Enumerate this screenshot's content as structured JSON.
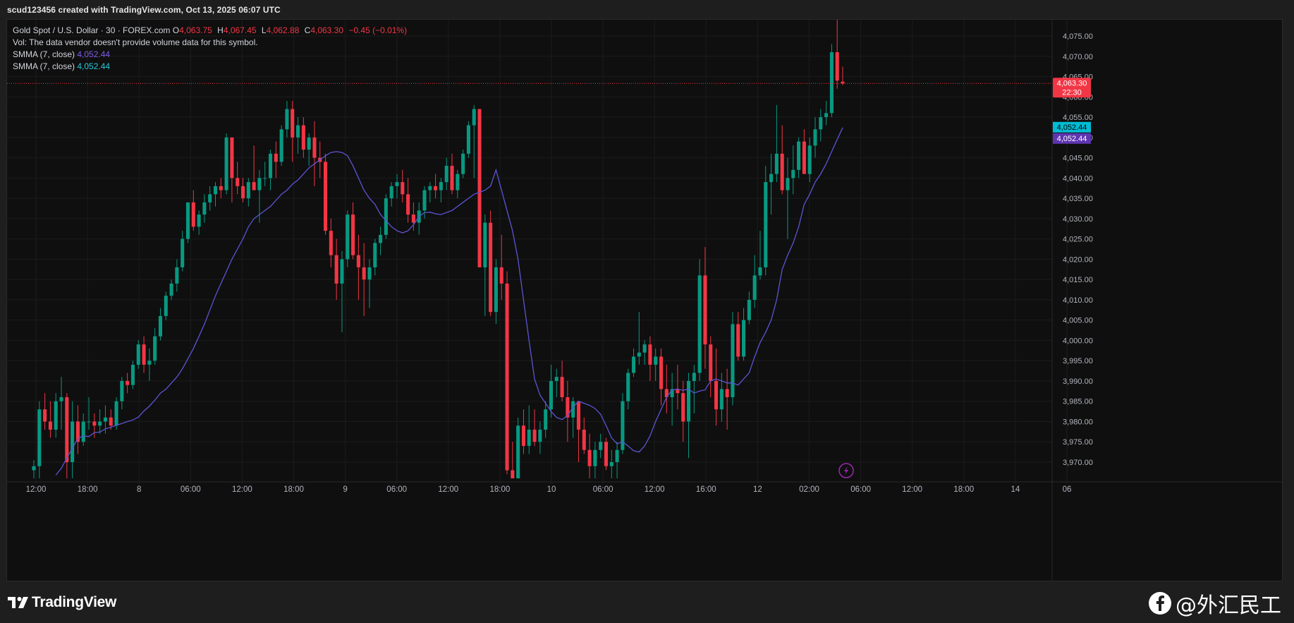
{
  "header": {
    "caption": "scud123456 created with TradingView.com, Oct 13, 2025 06:07 UTC"
  },
  "legend": {
    "symbol": "Gold Spot / U.S. Dollar · 30 · FOREX.com",
    "open_label": "O",
    "open": "4,063.75",
    "high_label": "H",
    "high": "4,067.45",
    "low_label": "L",
    "low": "4,062.88",
    "close_label": "C",
    "close": "4,063.30",
    "change": "−0.45 (−0.01%)",
    "volume_note": "Vol: The data vendor doesn't provide volume data for this symbol.",
    "smma1_label": "SMMA (7, close)",
    "smma1_value": "4,052.44",
    "smma2_label": "SMMA (7, close)",
    "smma2_value": "4,052.44"
  },
  "price_badge": {
    "price": "4,063.30",
    "countdown": "22:30"
  },
  "smma_badges": [
    "4,052.44",
    "4,052.44"
  ],
  "footer": {
    "brand": "TradingView",
    "watermark": "@外汇民工"
  },
  "colors": {
    "up": "#089981",
    "down": "#f23645",
    "smma": "#5b55d6",
    "smma_alt": "#00bcd4",
    "background": "#0f0f0f",
    "grid": "#1c1c1c"
  },
  "chart_data": {
    "type": "candlestick",
    "title": "Gold Spot / U.S. Dollar · 30 · FOREX.com",
    "ylim": [
      3966,
      4079
    ],
    "y_ticks": [
      3970,
      3975,
      3980,
      3985,
      3990,
      3995,
      4000,
      4005,
      4010,
      4015,
      4020,
      4025,
      4030,
      4035,
      4040,
      4045,
      4050,
      4055,
      4060,
      4065,
      4070,
      4075
    ],
    "x_ticks": [
      "12:00",
      "18:00",
      "8",
      "06:00",
      "12:00",
      "18:00",
      "9",
      "06:00",
      "12:00",
      "18:00",
      "10",
      "06:00",
      "12:00",
      "16:00",
      "12",
      "02:00",
      "06:00",
      "12:00",
      "18:00",
      "14",
      "06"
    ],
    "current_price": 4063.3,
    "candles": [
      [
        3968.0,
        3970.5,
        3966.0,
        3969.0
      ],
      [
        3969.0,
        3985.0,
        3966.0,
        3983.0
      ],
      [
        3983.0,
        3987.0,
        3978.0,
        3980.0
      ],
      [
        3980.0,
        3985.0,
        3976.0,
        3978.0
      ],
      [
        3978.0,
        3987.0,
        3976.0,
        3985.0
      ],
      [
        3985.0,
        3991.0,
        3978.0,
        3986.0
      ],
      [
        3986.0,
        3987.0,
        3966.0,
        3970.0
      ],
      [
        3970.0,
        3985.0,
        3966.0,
        3980.0
      ],
      [
        3980.0,
        3984.0,
        3972.0,
        3975.0
      ],
      [
        3975.0,
        3982.0,
        3974.0,
        3980.0
      ],
      [
        3980.0,
        3986.0,
        3978.0,
        3980.0
      ],
      [
        3980.0,
        3982.0,
        3976.0,
        3979.0
      ],
      [
        3979.0,
        3983.0,
        3977.0,
        3980.0
      ],
      [
        3980.0,
        3984.0,
        3977.0,
        3981.0
      ],
      [
        3981.0,
        3983.0,
        3978.0,
        3979.0
      ],
      [
        3979.0,
        3986.0,
        3978.0,
        3985.0
      ],
      [
        3985.0,
        3991.0,
        3983.0,
        3990.0
      ],
      [
        3990.0,
        3992.0,
        3987.0,
        3989.0
      ],
      [
        3989.0,
        3995.0,
        3988.0,
        3994.0
      ],
      [
        3994.0,
        4000.0,
        3993.0,
        3999.0
      ],
      [
        3999.0,
        4001.0,
        3992.0,
        3994.0
      ],
      [
        3994.0,
        3998.0,
        3990.0,
        3995.0
      ],
      [
        3995.0,
        4003.0,
        3994.0,
        4001.0
      ],
      [
        4001.0,
        4008.0,
        4000.0,
        4006.0
      ],
      [
        4006.0,
        4012.0,
        4005.0,
        4011.0
      ],
      [
        4011.0,
        4015.0,
        4010.0,
        4014.0
      ],
      [
        4014.0,
        4020.0,
        4012.0,
        4018.0
      ],
      [
        4018.0,
        4027.0,
        4017.0,
        4025.0
      ],
      [
        4025.0,
        4033.0,
        4024.0,
        4034.0
      ],
      [
        4034.0,
        4037.0,
        4027.0,
        4028.0
      ],
      [
        4028.0,
        4032.0,
        4026.0,
        4031.0
      ],
      [
        4031.0,
        4036.0,
        4029.0,
        4034.0
      ],
      [
        4034.0,
        4038.0,
        4032.0,
        4036.0
      ],
      [
        4036.0,
        4039.0,
        4033.0,
        4038.0
      ],
      [
        4038.0,
        4040.0,
        4035.0,
        4037.0
      ],
      [
        4037.0,
        4051.0,
        4036.0,
        4050.0
      ],
      [
        4050.0,
        4050.0,
        4034.0,
        4040.0
      ],
      [
        4040.0,
        4044.0,
        4036.0,
        4038.0
      ],
      [
        4038.0,
        4040.0,
        4034.0,
        4035.0
      ],
      [
        4035.0,
        4040.0,
        4033.0,
        4039.0
      ],
      [
        4039.0,
        4048.0,
        4038.0,
        4037.0
      ],
      [
        4037.0,
        4042.0,
        4029.0,
        4040.0
      ],
      [
        4040.0,
        4044.0,
        4038.0,
        4040.0
      ],
      [
        4040.0,
        4047.0,
        4037.0,
        4046.0
      ],
      [
        4046.0,
        4049.0,
        4040.0,
        4044.0
      ],
      [
        4044.0,
        4053.0,
        4043.0,
        4052.0
      ],
      [
        4052.0,
        4059.0,
        4050.0,
        4057.0
      ],
      [
        4057.0,
        4059.0,
        4044.0,
        4050.0
      ],
      [
        4050.0,
        4055.0,
        4046.0,
        4053.0
      ],
      [
        4053.0,
        4055.0,
        4045.0,
        4047.0
      ],
      [
        4047.0,
        4051.0,
        4043.0,
        4050.0
      ],
      [
        4050.0,
        4054.0,
        4038.0,
        4045.0
      ],
      [
        4045.0,
        4049.0,
        4040.0,
        4044.0
      ],
      [
        4044.0,
        4046.0,
        4026.0,
        4027.0
      ],
      [
        4027.0,
        4030.0,
        4018.0,
        4021.0
      ],
      [
        4021.0,
        4025.0,
        4010.0,
        4014.0
      ],
      [
        4014.0,
        4022.0,
        4002.0,
        4020.0
      ],
      [
        4020.0,
        4032.0,
        4018.0,
        4031.0
      ],
      [
        4031.0,
        4034.0,
        4020.0,
        4021.0
      ],
      [
        4021.0,
        4026.0,
        4010.0,
        4018.0
      ],
      [
        4018.0,
        4024.0,
        4006.0,
        4015.0
      ],
      [
        4015.0,
        4020.0,
        4008.0,
        4018.0
      ],
      [
        4018.0,
        4025.0,
        4016.0,
        4024.0
      ],
      [
        4024.0,
        4028.0,
        4021.0,
        4026.0
      ],
      [
        4026.0,
        4036.0,
        4025.0,
        4035.0
      ],
      [
        4035.0,
        4039.0,
        4033.0,
        4038.0
      ],
      [
        4038.0,
        4041.0,
        4035.0,
        4039.0
      ],
      [
        4039.0,
        4042.0,
        4034.0,
        4036.0
      ],
      [
        4036.0,
        4040.0,
        4029.0,
        4031.0
      ],
      [
        4031.0,
        4034.0,
        4027.0,
        4029.0
      ],
      [
        4029.0,
        4034.0,
        4026.0,
        4032.0
      ],
      [
        4032.0,
        4038.0,
        4030.0,
        4037.0
      ],
      [
        4037.0,
        4039.0,
        4034.0,
        4038.0
      ],
      [
        4038.0,
        4041.0,
        4035.0,
        4037.0
      ],
      [
        4037.0,
        4040.0,
        4034.0,
        4039.0
      ],
      [
        4039.0,
        4045.0,
        4037.0,
        4043.0
      ],
      [
        4043.0,
        4046.0,
        4036.0,
        4037.0
      ],
      [
        4037.0,
        4042.0,
        4035.0,
        4041.0
      ],
      [
        4041.0,
        4047.0,
        4040.0,
        4046.0
      ],
      [
        4046.0,
        4054.0,
        4045.0,
        4053.0
      ],
      [
        4053.0,
        4058.0,
        4040.0,
        4057.0
      ],
      [
        4057.0,
        4056.0,
        4018.0,
        4018.0
      ],
      [
        4018.0,
        4031.0,
        4006.0,
        4029.0
      ],
      [
        4029.0,
        4032.0,
        4006.0,
        4007.0
      ],
      [
        4007.0,
        4020.0,
        4004.0,
        4018.0
      ],
      [
        4018.0,
        4026.0,
        4010.0,
        4014.0
      ],
      [
        4014.0,
        4017.0,
        3967.0,
        3968.0
      ],
      [
        3968.0,
        3975.0,
        3966.0,
        3966.0
      ],
      [
        3966.0,
        3981.0,
        3966.0,
        3979.0
      ],
      [
        3979.0,
        3983.0,
        3972.0,
        3974.0
      ],
      [
        3974.0,
        3984.0,
        3972.0,
        3978.0
      ],
      [
        3978.0,
        3983.0,
        3974.0,
        3975.0
      ],
      [
        3975.0,
        3980.0,
        3972.0,
        3978.0
      ],
      [
        3978.0,
        3985.0,
        3976.0,
        3983.0
      ],
      [
        3983.0,
        3994.0,
        3981.0,
        3990.0
      ],
      [
        3990.0,
        3993.0,
        3986.0,
        3991.0
      ],
      [
        3991.0,
        3995.0,
        3985.0,
        3986.0
      ],
      [
        3986.0,
        3990.0,
        3975.0,
        3981.0
      ],
      [
        3981.0,
        3986.0,
        3976.0,
        3985.0
      ],
      [
        3985.0,
        3985.0,
        3970.0,
        3978.0
      ],
      [
        3978.0,
        3981.0,
        3972.0,
        3973.0
      ],
      [
        3973.0,
        3977.0,
        3966.0,
        3969.0
      ],
      [
        3969.0,
        3975.0,
        3966.0,
        3973.0
      ],
      [
        3973.0,
        3977.0,
        3971.0,
        3975.0
      ],
      [
        3975.0,
        3976.0,
        3968.0,
        3969.0
      ],
      [
        3969.0,
        3973.0,
        3966.0,
        3970.0
      ],
      [
        3970.0,
        3975.0,
        3966.0,
        3973.0
      ],
      [
        3973.0,
        3987.0,
        3972.0,
        3985.0
      ],
      [
        3985.0,
        3993.0,
        3983.0,
        3992.0
      ],
      [
        3992.0,
        3998.0,
        3991.0,
        3996.0
      ],
      [
        3996.0,
        4007.0,
        3994.0,
        3997.0
      ],
      [
        3997.0,
        4000.0,
        3994.0,
        3999.0
      ],
      [
        3999.0,
        4001.0,
        3990.0,
        3994.0
      ],
      [
        3994.0,
        3998.0,
        3990.0,
        3996.0
      ],
      [
        3996.0,
        3998.0,
        3984.0,
        3988.0
      ],
      [
        3988.0,
        3994.0,
        3982.0,
        3986.0
      ],
      [
        3986.0,
        3992.0,
        3979.0,
        3988.0
      ],
      [
        3988.0,
        3994.0,
        3983.0,
        3987.0
      ],
      [
        3987.0,
        3990.0,
        3975.0,
        3980.0
      ],
      [
        3980.0,
        3992.0,
        3971.0,
        3990.0
      ],
      [
        3990.0,
        3994.0,
        3982.0,
        3992.0
      ],
      [
        3992.0,
        4020.0,
        3990.0,
        4016.0
      ],
      [
        4016.0,
        4023.0,
        3993.0,
        3999.0
      ],
      [
        3999.0,
        4001.0,
        3986.0,
        3990.0
      ],
      [
        3990.0,
        3998.0,
        3979.0,
        3983.0
      ],
      [
        3983.0,
        3992.0,
        3980.0,
        3988.0
      ],
      [
        3988.0,
        3993.0,
        3978.0,
        3986.0
      ],
      [
        3986.0,
        4007.0,
        3984.0,
        4004.0
      ],
      [
        4004.0,
        4007.0,
        3995.0,
        3996.0
      ],
      [
        3996.0,
        4008.0,
        3995.0,
        4005.0
      ],
      [
        4005.0,
        4012.0,
        4004.0,
        4010.0
      ],
      [
        4010.0,
        4021.0,
        4008.0,
        4016.0
      ],
      [
        4016.0,
        4027.0,
        4015.0,
        4018.0
      ],
      [
        4018.0,
        4043.0,
        4016.0,
        4039.0
      ],
      [
        4039.0,
        4046.0,
        4031.0,
        4041.0
      ],
      [
        4041.0,
        4058.0,
        4039.0,
        4046.0
      ],
      [
        4046.0,
        4053.0,
        4036.0,
        4037.0
      ],
      [
        4037.0,
        4045.0,
        4025.0,
        4040.0
      ],
      [
        4040.0,
        4048.0,
        4036.0,
        4042.0
      ],
      [
        4042.0,
        4050.0,
        4040.0,
        4049.0
      ],
      [
        4049.0,
        4052.0,
        4042.0,
        4041.0
      ],
      [
        4041.0,
        4050.0,
        4039.0,
        4048.0
      ],
      [
        4048.0,
        4055.0,
        4045.0,
        4052.0
      ],
      [
        4052.0,
        4057.0,
        4049.0,
        4055.0
      ],
      [
        4055.0,
        4059.0,
        4053.0,
        4056.0
      ],
      [
        4056.0,
        4073.0,
        4055.0,
        4071.0
      ],
      [
        4071.0,
        4079.0,
        4062.0,
        4064.0
      ],
      [
        4063.75,
        4067.45,
        4062.88,
        4063.3
      ]
    ],
    "smma": [
      3966.8,
      3968.5,
      3971.0,
      3973.4,
      3975.8,
      3976.5,
      3976.3,
      3977.3,
      3977.4,
      3978.2,
      3978.6,
      3979.1,
      3979.5,
      3980.0,
      3980.4,
      3981.1,
      3982.6,
      3983.8,
      3985.3,
      3987.0,
      3988.0,
      3989.5,
      3991.0,
      3993.0,
      3995.5,
      3998.0,
      4001.0,
      4004.0,
      4007.5,
      4011.0,
      4014.0,
      4017.0,
      4020.0,
      4022.5,
      4025.0,
      4028.0,
      4030.0,
      4031.0,
      4032.0,
      4033.0,
      4034.5,
      4036.0,
      4037.0,
      4038.5,
      4039.5,
      4041.0,
      4042.5,
      4043.5,
      4044.5,
      4045.5,
      4046.3,
      4046.5,
      4046.3,
      4045.5,
      4043.0,
      4040.0,
      4037.0,
      4035.0,
      4033.5,
      4031.0,
      4029.5,
      4028.0,
      4027.0,
      4026.5,
      4027.0,
      4028.5,
      4030.5,
      4031.5,
      4031.6,
      4031.2,
      4031.0,
      4031.5,
      4032.0,
      4033.0,
      4034.0,
      4035.0,
      4036.0,
      4036.5,
      4037.0,
      4038.0,
      4042.0,
      4037.0,
      4032.0,
      4027.0,
      4020.0,
      4010.0,
      4000.0,
      3990.5,
      3986.5,
      3984.5,
      3982.5,
      3981.0,
      3980.5,
      3981.5,
      3983.5,
      3985.0,
      3984.5,
      3984.0,
      3983.2,
      3981.8,
      3979.0,
      3976.0,
      3974.5,
      3975.0,
      3974.0,
      3972.8,
      3972.5,
      3974.0,
      3976.5,
      3980.0,
      3983.0,
      3986.0,
      3987.8,
      3988.0,
      3987.7,
      3988.0,
      3987.0,
      3987.5,
      3987.8,
      3990.0,
      3990.5,
      3990.0,
      3989.5,
      3989.5,
      3989.0,
      3990.5,
      3992.0,
      3996.0,
      3999.5,
      4002.0,
      4005.0,
      4010.0,
      4017.5,
      4021.0,
      4024.0,
      4028.0,
      4033.5,
      4036.0,
      4039.0,
      4041.0,
      4043.5,
      4046.5,
      4049.5,
      4052.44
    ]
  }
}
